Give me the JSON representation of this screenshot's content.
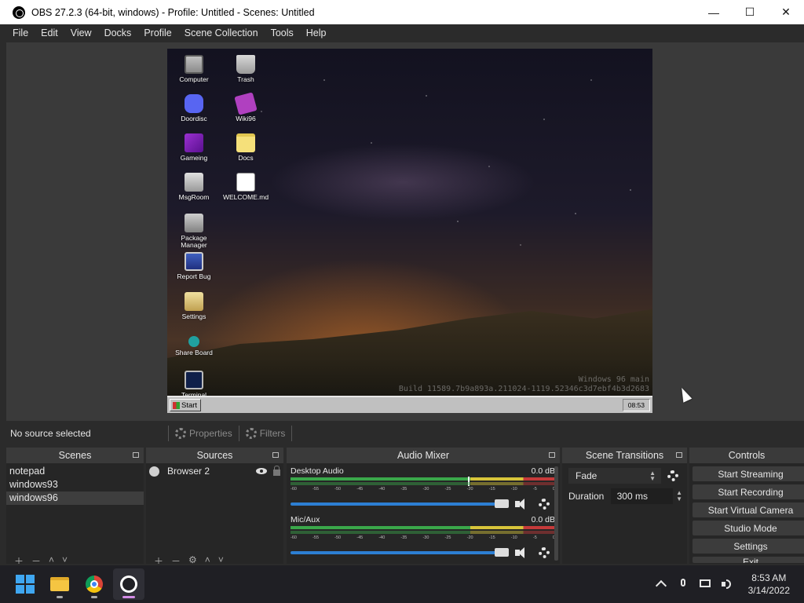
{
  "window": {
    "title": "OBS 27.2.3 (64-bit, windows) - Profile: Untitled - Scenes: Untitled",
    "minimize": "—",
    "maximize": "☐",
    "close": "✕"
  },
  "menu": [
    "File",
    "Edit",
    "View",
    "Docks",
    "Profile",
    "Scene Collection",
    "Tools",
    "Help"
  ],
  "preview": {
    "icons": [
      {
        "label": "Computer",
        "icon": "computer-icon"
      },
      {
        "label": "Trash",
        "icon": "trash-icon"
      },
      {
        "label": "Doordisc",
        "icon": "discord-icon"
      },
      {
        "label": "Wiki96",
        "icon": "wiki-icon"
      },
      {
        "label": "Gameing",
        "icon": "cube-icon"
      },
      {
        "label": "Docs",
        "icon": "folder-icon"
      },
      {
        "label": "MsgRoom",
        "icon": "msgroom-icon"
      },
      {
        "label": "WELCOME.md",
        "icon": "file-icon"
      },
      {
        "label": "Package Manager",
        "icon": "package-icon"
      },
      {
        "label": "Report Bug",
        "icon": "bug-icon"
      },
      {
        "label": "Settings",
        "icon": "settings-icon"
      },
      {
        "label": "Share Board",
        "icon": "share-icon"
      },
      {
        "label": "Terminal",
        "icon": "terminal-icon"
      }
    ],
    "watermark_line1": "Windows 96 main",
    "watermark_line2": "Build 11589.7b9a893a.211024-1119.52346c3d7ebf4b3d2683",
    "start_label": "Start",
    "clock": "08:53"
  },
  "source_toolbar": {
    "status": "No source selected",
    "properties": "Properties",
    "filters": "Filters"
  },
  "docks": {
    "scenes": {
      "title": "Scenes",
      "items": [
        "notepad",
        "windows93",
        "windows96"
      ],
      "selected": "windows96"
    },
    "sources": {
      "title": "Sources",
      "items": [
        "Browser 2"
      ]
    },
    "mixer": {
      "title": "Audio Mixer",
      "ticks": [
        "-60",
        "-55",
        "-50",
        "-45",
        "-40",
        "-35",
        "-30",
        "-25",
        "-20",
        "-15",
        "-10",
        "-5",
        "0"
      ],
      "channels": [
        {
          "name": "Desktop Audio",
          "level": "0.0 dB"
        },
        {
          "name": "Mic/Aux",
          "level": "0.0 dB"
        }
      ]
    },
    "transitions": {
      "title": "Scene Transitions",
      "selected": "Fade",
      "duration_label": "Duration",
      "duration_value": "300 ms"
    },
    "controls": {
      "title": "Controls",
      "buttons": [
        "Start Streaming",
        "Start Recording",
        "Start Virtual Camera",
        "Studio Mode",
        "Settings",
        "Exit"
      ]
    }
  },
  "taskbar": {
    "time": "8:53 AM",
    "date": "3/14/2022"
  },
  "colors": {
    "meter_green": "#3aa84a",
    "meter_yellow": "#d8c53a",
    "meter_red": "#c53a3a",
    "volume_blue": "#2d7fd3"
  }
}
